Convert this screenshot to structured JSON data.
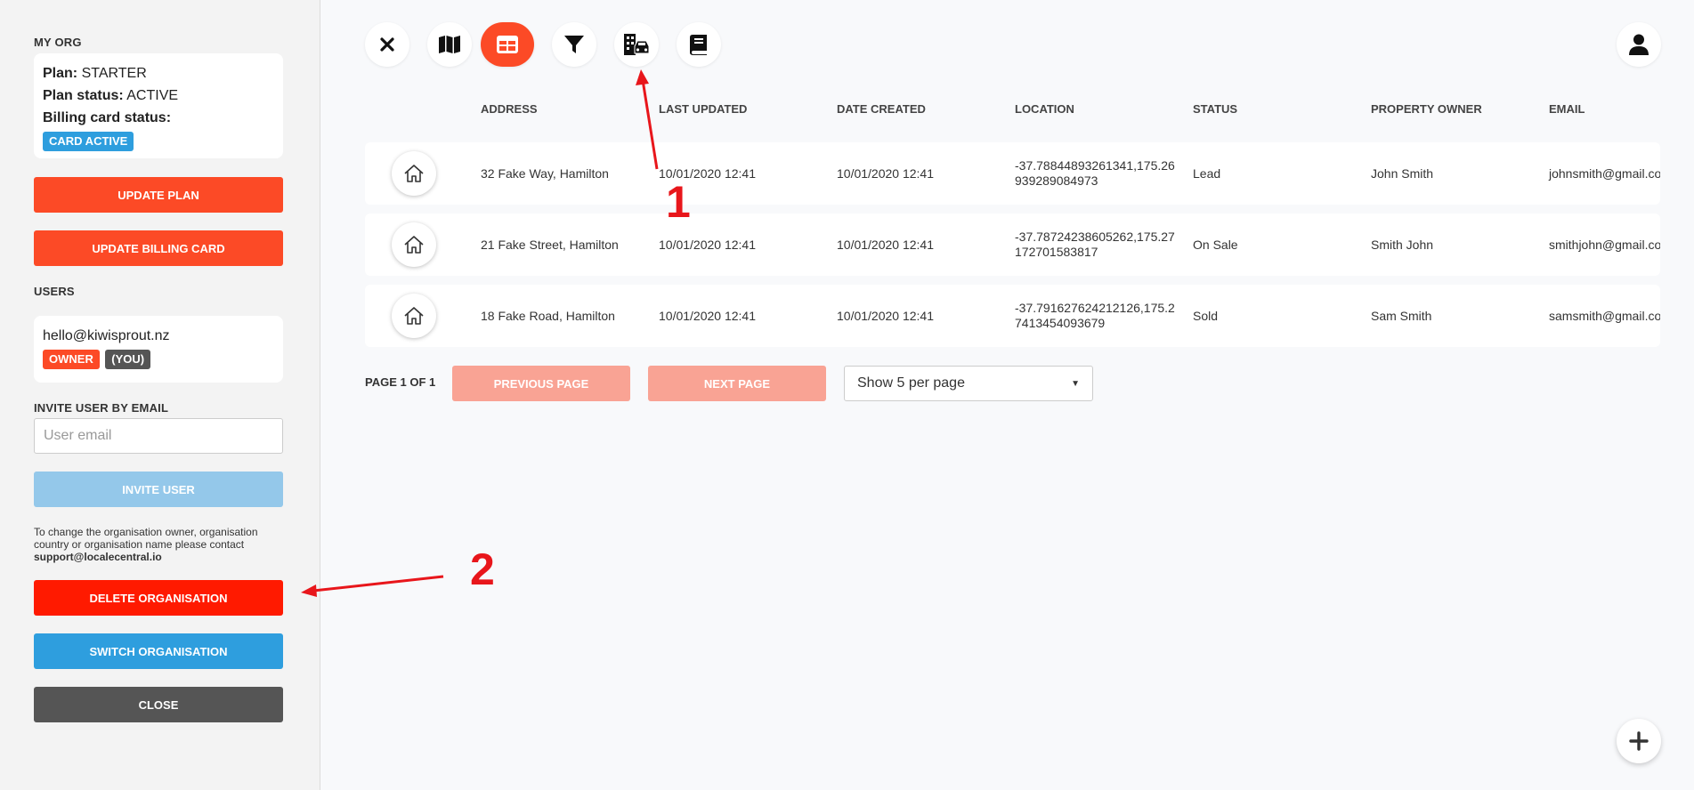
{
  "sidebar": {
    "my_org_title": "MY ORG",
    "plan_label": "Plan:",
    "plan_value": "STARTER",
    "plan_status_label": "Plan status:",
    "plan_status_value": "ACTIVE",
    "billing_label": "Billing card status:",
    "billing_badge": "CARD ACTIVE",
    "update_plan": "UPDATE PLAN",
    "update_billing": "UPDATE BILLING CARD",
    "users_title": "USERS",
    "user_email": "hello@kiwisprout.nz",
    "owner_badge": "OWNER",
    "you_badge": "(YOU)",
    "invite_title": "INVITE USER BY EMAIL",
    "invite_placeholder": "User email",
    "invite_button": "INVITE USER",
    "note_text": "To change the organisation owner, organisation country or organisation name please contact",
    "note_email": "support@localecentral.io",
    "delete_org": "DELETE ORGANISATION",
    "switch_org": "SWITCH ORGANISATION",
    "close": "CLOSE"
  },
  "toolbar": [
    {
      "name": "close-icon"
    },
    {
      "name": "map-icon"
    },
    {
      "name": "table-icon",
      "active": true
    },
    {
      "name": "filter-icon"
    },
    {
      "name": "building-car-icon"
    },
    {
      "name": "book-icon"
    }
  ],
  "table": {
    "headers": [
      "ADDRESS",
      "LAST UPDATED",
      "DATE CREATED",
      "LOCATION",
      "STATUS",
      "PROPERTY OWNER",
      "EMAIL"
    ],
    "rows": [
      {
        "address": "32 Fake Way, Hamilton",
        "updated": "10/01/2020 12:41",
        "created": "10/01/2020 12:41",
        "location": "-37.78844893261341,175.26939289084973",
        "status": "Lead",
        "owner": "John Smith",
        "email": "johnsmith@gmail.com"
      },
      {
        "address": "21 Fake Street, Hamilton",
        "updated": "10/01/2020 12:41",
        "created": "10/01/2020 12:41",
        "location": "-37.78724238605262,175.27172701583817",
        "status": "On Sale",
        "owner": "Smith John",
        "email": "smithjohn@gmail.com"
      },
      {
        "address": "18 Fake Road, Hamilton",
        "updated": "10/01/2020 12:41",
        "created": "10/01/2020 12:41",
        "location": "-37.791627624212126,175.27413454093679",
        "status": "Sold",
        "owner": "Sam Smith",
        "email": "samsmith@gmail.com"
      }
    ]
  },
  "pagination": {
    "label": "PAGE 1 OF 1",
    "prev": "PREVIOUS PAGE",
    "next": "NEXT PAGE",
    "per_page": "Show 5 per page"
  },
  "annotations": {
    "one": "1",
    "two": "2"
  },
  "colors": {
    "accent": "#fc4a26",
    "delete": "#ff1a00",
    "switch": "#2e9ede",
    "close": "#555555",
    "invite_disabled": "#94c8ea",
    "pager_disabled": "#f9a394",
    "annotation": "#e8161b"
  }
}
